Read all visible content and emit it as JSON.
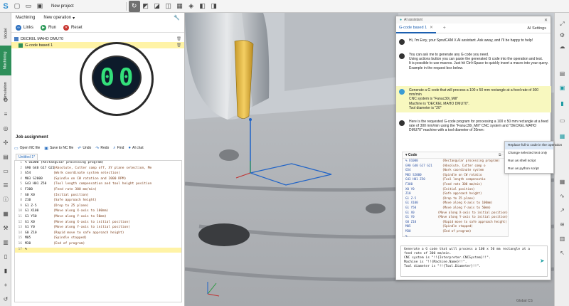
{
  "toolbar": {
    "title": "New project"
  },
  "lefttabs": [
    "Model",
    "Machining",
    "Simulation"
  ],
  "leftpanel": {
    "tab": "Machining",
    "operation": "New operation",
    "actions": [
      "Links",
      "Run",
      "Reset"
    ],
    "tree": [
      "DECKEL MAHO DMU70",
      "G-code based 1"
    ],
    "job_title": "Job assignment",
    "job_tools": [
      "Open NC file",
      "Save to NC file",
      "Undo",
      "Redo",
      "Find",
      "AI chat"
    ],
    "file_tab": "Untitled 1*",
    "emblem": [
      "0",
      "0"
    ],
    "code": [
      {
        "n": "1",
        "t": "% O1000 (Rectangular processing program)",
        "c": ""
      },
      {
        "n": "2",
        "t": "G90 G40 G17 G21",
        "c": "(Absolute, Cutter comp off, XY plane selection, Me"
      },
      {
        "n": "3",
        "t": "G54",
        "c": "(Work coordinate system selection)"
      },
      {
        "n": "4",
        "t": "M03 S2000",
        "c": "(Spindle on CW rotation and 2000 RPM)"
      },
      {
        "n": "5",
        "t": "G43 H01 Z50",
        "c": "(Tool length compensation and tool height position"
      },
      {
        "n": "6",
        "t": "F300",
        "c": "(Feed rate 300 mm/min)"
      },
      {
        "n": "7",
        "t": "G0 X0",
        "c": "(Initial position)"
      },
      {
        "n": "8",
        "t": "Z10",
        "c": "(Safe approach height)"
      },
      {
        "n": "9",
        "t": "G1 Z-5",
        "c": "(Drop to Z5 plane)"
      },
      {
        "n": "10",
        "t": "G1 X100",
        "c": "(Move along X-axis to 100mm)"
      },
      {
        "n": "11",
        "t": "G1 Y50",
        "c": "(Move along Y-axis to 50mm)"
      },
      {
        "n": "12",
        "t": "G1 X0",
        "c": "(Move along X-axis to initial position)"
      },
      {
        "n": "13",
        "t": "G1 Y0",
        "c": "(Move along Y-axis to initial position)"
      },
      {
        "n": "14",
        "t": "G0 Z10",
        "c": "(Rapid move to safe approach height)"
      },
      {
        "n": "15",
        "t": "M05",
        "c": "(Spindle stopped)"
      },
      {
        "n": "16",
        "t": "M30",
        "c": "(End of program)"
      },
      {
        "n": "17",
        "t": "%",
        "c": ""
      }
    ]
  },
  "ai": {
    "window_title": "AI assistant",
    "tab": "G-code based 1",
    "plus": "+",
    "settings": "AI Settings",
    "messages": [
      {
        "role": "bot",
        "lines": [
          "Hi, I'm Evry, your SprutCAM X AI assistant. Ask away, and I'll be happy to help!"
        ]
      },
      {
        "role": "bot",
        "lines": [
          "You can ask me to generate any G code you need.",
          "Using actions button you can paste the generated G code into the operation and test.",
          "It is possible to use macros. Just hit Ctrl+Space to quickly insert a macro into your query.",
          "Example in the request box below."
        ]
      },
      {
        "role": "user",
        "lines": [
          "Generate a G code that will process a 100 x 50 mm rectangle at a feed rate of 300 mm/min",
          "CNC system is \"Fanuc30i_Mill\"",
          "Machine is \"DECKEL MAHO DMU70\".",
          "Tool diameter is \"20\""
        ]
      },
      {
        "role": "bot",
        "lines": [
          "Here is the requested G-code program for processing a 100 x 50 mm rectangle at a feed rate of 300 mm/min using the \"Fanuc30i_Mill\" CNC system and \"DECKEL MAHO DMU70\" machine with a tool diameter of 20mm:"
        ]
      }
    ],
    "code_title": "Code",
    "code": [
      {
        "t": "% O1000",
        "c": "(Rectangular processing program)"
      },
      {
        "t": "G90 G40 G17 G21",
        "c": "(Absolute, Cutter comp o"
      },
      {
        "t": "G54",
        "c": "(Work coordinate system"
      },
      {
        "t": "M03 S2000",
        "c": "(Spindle on CW rotatio"
      },
      {
        "t": "G43 H01 Z50",
        "c": "(Tool length compensatio"
      },
      {
        "t": "F300",
        "c": "(Feed rate 300 mm/min)"
      },
      {
        "t": "X0 Y0",
        "c": "(Initial position)"
      },
      {
        "t": "Z10",
        "c": "(Safe approach height)"
      },
      {
        "t": "G1 Z-5",
        "c": "(Drop to Z5 plane)"
      },
      {
        "t": "G1 X100",
        "c": "(Move along X-axis to 100mm)"
      },
      {
        "t": "G1 Y50",
        "c": "(Move along Y-axis to 50mm)"
      },
      {
        "t": "G1 X0",
        "c": "(Move along X-axis to initial position)"
      },
      {
        "t": "G1 Y0",
        "c": "(Move along Y-axis to initial position)"
      },
      {
        "t": "G0 Z10",
        "c": "(Rapid move to safe approach height)"
      },
      {
        "t": "M05",
        "c": "(Spindle stopped)"
      },
      {
        "t": "M30",
        "c": "(End of program)"
      },
      {
        "t": "%",
        "c": ""
      }
    ],
    "context_menu": [
      "Replace full G code in the operation",
      "Change selected text only",
      "Run as shell script",
      "Run as python script"
    ],
    "input": [
      "Generate a G code that will process a 100 x 50 mm rectangle at a",
      "  feed rate of 300 mm/min.",
      "CNC system is \"!!{Interpreter.CNCSystem}!!\".",
      "Machine is \"!!{Machine.Name}!!\".",
      "Tool diameter is \"!!{Tool.Diameter}!!\"."
    ]
  },
  "status": "Global CS"
}
